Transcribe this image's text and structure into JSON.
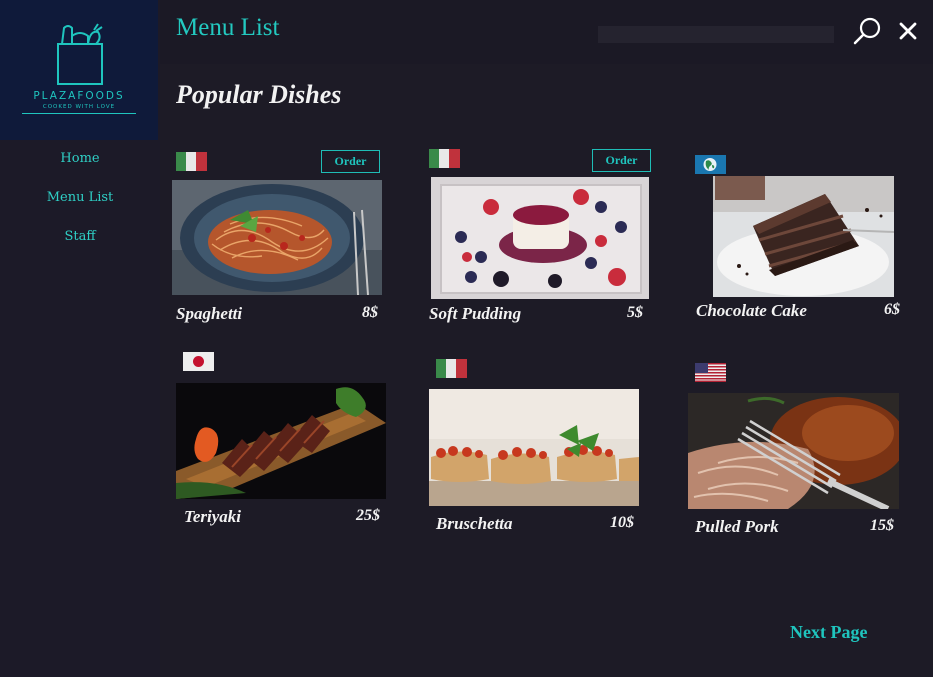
{
  "logo": {
    "brand": "PLAZAFOODS",
    "tagline": "COOKED WITH LOVE"
  },
  "sidebar": {
    "items": [
      {
        "label": "Home"
      },
      {
        "label": "Menu List"
      },
      {
        "label": "Staff"
      }
    ]
  },
  "header": {
    "title": "Menu List",
    "search_placeholder": ""
  },
  "section_title": "Popular Dishes",
  "dishes": [
    {
      "name": "Spaghetti",
      "price": "8$",
      "flag": "italy-flag",
      "order_label": "Order"
    },
    {
      "name": "Soft Pudding",
      "price": "5$",
      "flag": "italy-flag",
      "order_label": "Order"
    },
    {
      "name": "Chocolate Cake",
      "price": "6$",
      "flag": "globe-flag"
    },
    {
      "name": "Teriyaki",
      "price": "25$",
      "flag": "japan-flag"
    },
    {
      "name": "Bruschetta",
      "price": "10$",
      "flag": "italy-flag"
    },
    {
      "name": "Pulled Pork",
      "price": "15$",
      "flag": "usa-flag"
    }
  ],
  "next_page_label": "Next Page",
  "colors": {
    "accent": "#1fc5be",
    "background": "#1d1b26",
    "sidebar": "#1c1a28",
    "logo_bg": "#0f1a3a"
  }
}
